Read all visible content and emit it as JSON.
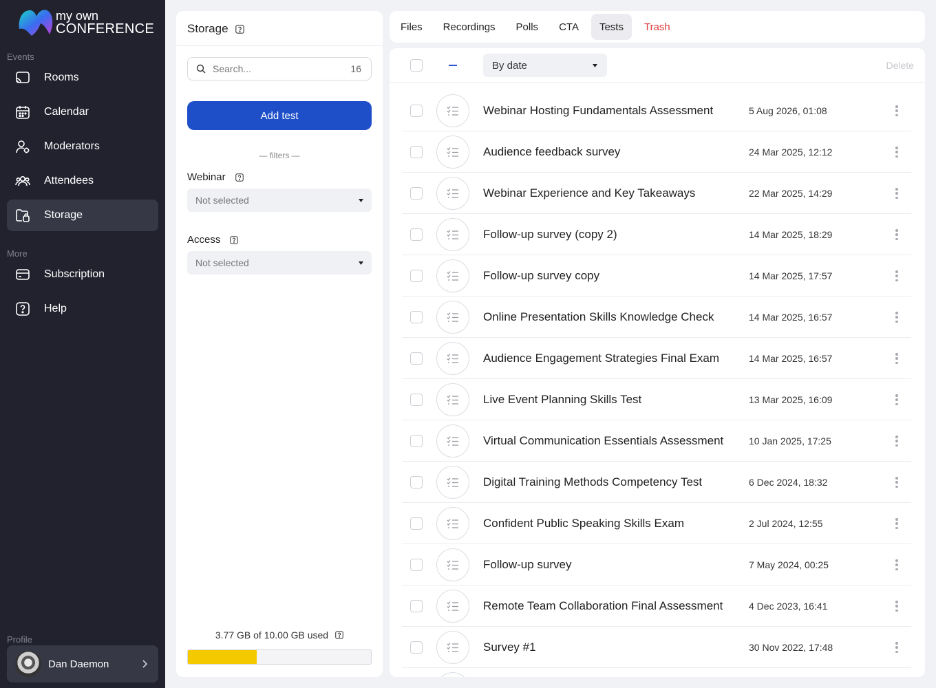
{
  "app": {
    "logo_line1": "my own",
    "logo_line2": "CONFERENCE"
  },
  "sidebar": {
    "events_label": "Events",
    "more_label": "More",
    "profile_label": "Profile",
    "items": [
      {
        "label": "Rooms",
        "icon": "cast-icon"
      },
      {
        "label": "Calendar",
        "icon": "calendar-icon"
      },
      {
        "label": "Moderators",
        "icon": "moderator-icon"
      },
      {
        "label": "Attendees",
        "icon": "attendees-icon"
      },
      {
        "label": "Storage",
        "icon": "folder-icon",
        "active": true
      }
    ],
    "more_items": [
      {
        "label": "Subscription",
        "icon": "card-icon"
      },
      {
        "label": "Help",
        "icon": "help-icon"
      }
    ],
    "user_name": "Dan Daemon"
  },
  "storage": {
    "title": "Storage",
    "search_placeholder": "Search...",
    "search_count": "16",
    "add_button": "Add test",
    "filters_label": "— filters —",
    "webinar_label": "Webinar",
    "webinar_value": "Not selected",
    "access_label": "Access",
    "access_value": "Not selected",
    "usage_text": "3.77 GB of 10.00 GB used",
    "usage_fraction": 0.377
  },
  "tabs": [
    {
      "label": "Files"
    },
    {
      "label": "Recordings"
    },
    {
      "label": "Polls"
    },
    {
      "label": "CTA"
    },
    {
      "label": "Tests",
      "active": true
    },
    {
      "label": "Trash"
    }
  ],
  "list": {
    "sort_label": "By date",
    "delete_label": "Delete",
    "rows": [
      {
        "name": "Webinar Hosting Fundamentals Assessment",
        "date": "5 Aug 2026, 01:08"
      },
      {
        "name": "Audience feedback survey",
        "date": "24 Mar 2025, 12:12"
      },
      {
        "name": "Webinar Experience and Key Takeaways",
        "date": "22 Mar 2025, 14:29"
      },
      {
        "name": "Follow-up survey (copy 2)",
        "date": "14 Mar 2025, 18:29"
      },
      {
        "name": "Follow-up survey copy",
        "date": "14 Mar 2025, 17:57"
      },
      {
        "name": "Online Presentation Skills Knowledge Check",
        "date": "14 Mar 2025, 16:57"
      },
      {
        "name": "Audience Engagement Strategies Final Exam",
        "date": "14 Mar 2025, 16:57"
      },
      {
        "name": "Live Event Planning Skills Test",
        "date": "13 Mar 2025, 16:09"
      },
      {
        "name": "Virtual Communication Essentials Assessment",
        "date": "10 Jan 2025, 17:25"
      },
      {
        "name": "Digital Training Methods Competency Test",
        "date": "6 Dec 2024, 18:32"
      },
      {
        "name": "Confident Public Speaking Skills Exam",
        "date": "2 Jul 2024, 12:55"
      },
      {
        "name": "Follow-up survey",
        "date": "7 May 2024, 00:25"
      },
      {
        "name": "Remote Team Collaboration Final Assessment",
        "date": "4 Dec 2023, 16:41"
      },
      {
        "name": "Survey #1",
        "date": "30 Nov 2022, 17:48"
      }
    ]
  }
}
